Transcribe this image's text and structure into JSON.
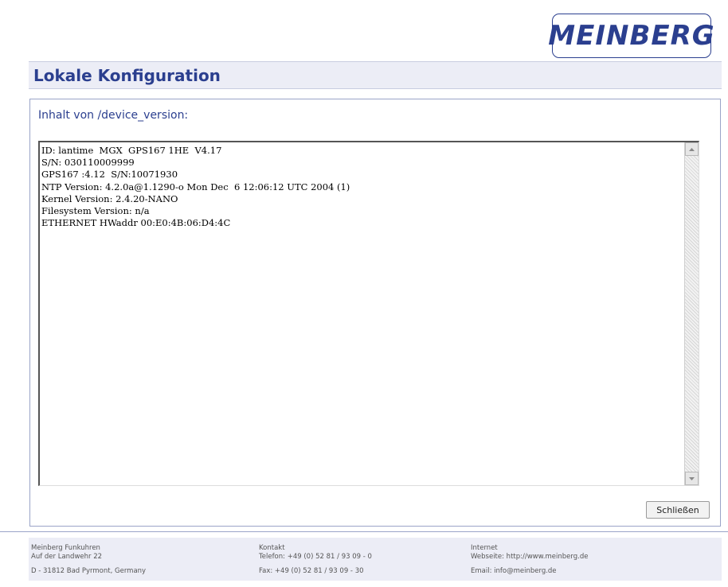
{
  "logo": {
    "text": "MEINBERG"
  },
  "page": {
    "title": "Lokale Konfiguration"
  },
  "panel": {
    "heading": "Inhalt von /device_version:",
    "content": "ID: lantime  MGX  GPS167 1HE  V4.17\nS/N: 030110009999\nGPS167 :4.12  S/N:10071930\nNTP Version: 4.2.0a@1.1290-o Mon Dec  6 12:06:12 UTC 2004 (1)\nKernel Version: 2.4.20-NANO\nFilesystem Version: n/a\nETHERNET HWaddr 00:E0:4B:06:D4:4C",
    "close_label": "Schließen"
  },
  "icons": {
    "scroll_up": "scroll-up-arrow",
    "scroll_down": "scroll-down-arrow"
  },
  "colors": {
    "brand": "#2b3f8f",
    "title_bar": "#ecedf6",
    "footer": "#ecedf6"
  },
  "footer": {
    "company": {
      "name": "Meinberg Funkuhren",
      "street": "Auf der Landwehr 22",
      "city": "D - 31812 Bad Pyrmont, Germany"
    },
    "contact": {
      "heading": "Kontakt",
      "phone": "Telefon: +49 (0) 52 81 / 93 09 - 0",
      "fax": "Fax: +49 (0) 52 81 / 93 09 - 30"
    },
    "internet": {
      "heading": "Internet",
      "website": "Webseite: http://www.meinberg.de",
      "email": "Email: info@meinberg.de"
    }
  }
}
